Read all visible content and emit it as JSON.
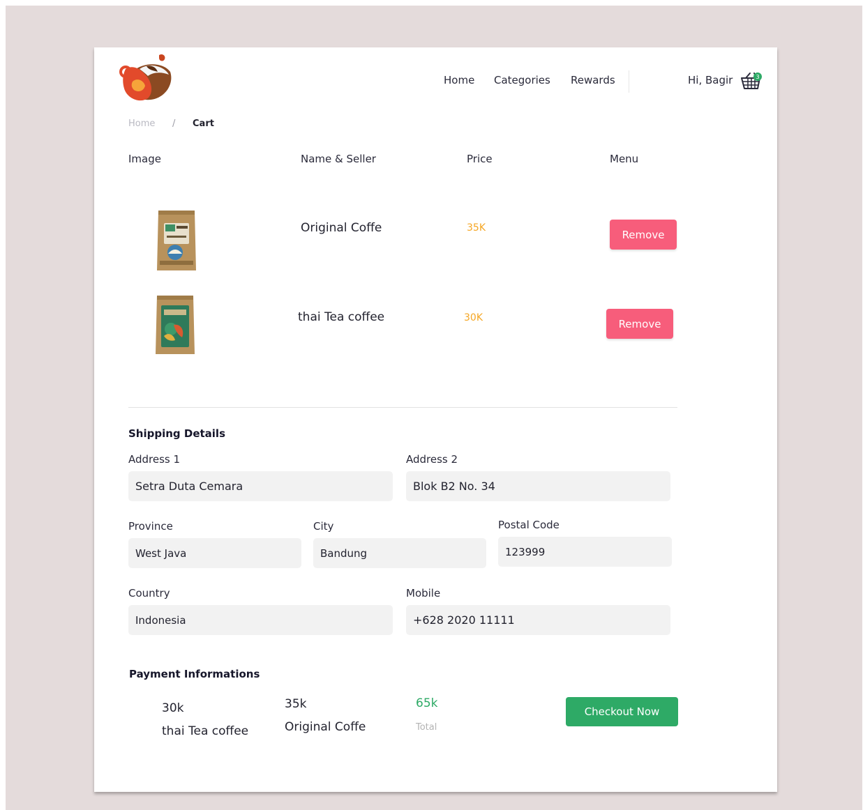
{
  "header": {
    "nav": [
      {
        "label": "Home"
      },
      {
        "label": "Categories"
      },
      {
        "label": "Rewards"
      }
    ],
    "greeting": "Hi, Bagir",
    "cart_badge": "3",
    "logo_icon": "coffee-cup-splash-logo",
    "cart_icon": "shopping-basket-icon"
  },
  "breadcrumb": {
    "home": "Home",
    "separator": "/",
    "current": "Cart"
  },
  "table": {
    "headers": [
      "Image",
      "Name & Seller",
      "Price",
      "Menu"
    ],
    "rows": [
      {
        "name": "Original Coffe",
        "price": "35K",
        "action": "Remove"
      },
      {
        "name": "thai Tea coffee",
        "price": "30K",
        "action": "Remove"
      }
    ]
  },
  "shipping": {
    "title": "Shipping Details",
    "address1": {
      "label": "Address 1",
      "value": "Setra Duta Cemara"
    },
    "address2": {
      "label": "Address 2",
      "value": "Blok B2 No. 34"
    },
    "province": {
      "label": "Province",
      "value": "West Java"
    },
    "city": {
      "label": "City",
      "value": "Bandung"
    },
    "postal": {
      "label": "Postal Code",
      "value": "123999"
    },
    "country": {
      "label": "Country",
      "value": "Indonesia"
    },
    "mobile": {
      "label": "Mobile",
      "value": "+628 2020 11111"
    }
  },
  "payment": {
    "title": "Payment Informations",
    "items": [
      {
        "price": "30k",
        "name": "thai Tea coffee"
      },
      {
        "price": "35k",
        "name": "Original Coffe"
      }
    ],
    "total_value": "65k",
    "total_label": "Total",
    "checkout_label": "Checkout Now"
  },
  "colors": {
    "background": "#e4dbdb",
    "remove_button": "#f75d7b",
    "price": "#f5a623",
    "checkout_button": "#2eaa66",
    "field_background": "#f2f2f2"
  }
}
